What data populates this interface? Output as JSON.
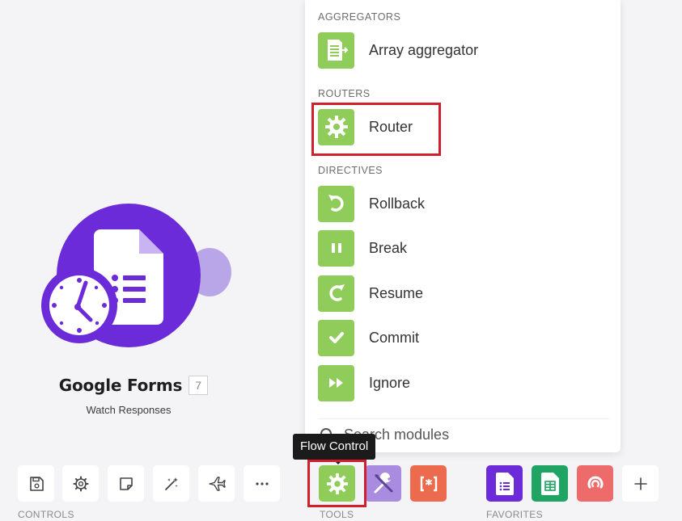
{
  "module": {
    "title": "Google Forms",
    "badge": "7",
    "subtitle": "Watch Responses",
    "color": "#6c2bd9"
  },
  "menu": {
    "sections": [
      {
        "label": "AGGREGATORS",
        "items": [
          {
            "label": "Array aggregator",
            "icon": "array-aggregator-icon"
          }
        ]
      },
      {
        "label": "ROUTERS",
        "items": [
          {
            "label": "Router",
            "icon": "gear-icon"
          }
        ]
      },
      {
        "label": "DIRECTIVES",
        "items": [
          {
            "label": "Rollback",
            "icon": "rollback-icon"
          },
          {
            "label": "Break",
            "icon": "pause-icon"
          },
          {
            "label": "Resume",
            "icon": "resume-icon"
          },
          {
            "label": "Commit",
            "icon": "checkmark-icon"
          },
          {
            "label": "Ignore",
            "icon": "fast-forward-icon"
          }
        ]
      }
    ],
    "accent": "#8fcc5a",
    "search_placeholder": "Search modules"
  },
  "tooltip": "Flow Control",
  "toolbar": {
    "controls_label": "CONTROLS",
    "tools_label": "TOOLS",
    "favorites_label": "FAVORITES",
    "controls": [
      "save-icon",
      "gear-icon",
      "note-icon",
      "magic-wand-icon",
      "airplane-icon",
      "ellipsis-icon"
    ],
    "tools": [
      "flow-control-gear-icon",
      "tools-icon",
      "text-parser-icon"
    ],
    "favorites": [
      "google-forms-icon",
      "google-sheets-icon",
      "scenario-app-icon",
      "plus-icon"
    ]
  },
  "colors": {
    "highlight": "#d0202e",
    "tools_purple": "#a98be0",
    "tools_red": "#ec6b4f",
    "sheets_green": "#1fa463",
    "favorite_red": "#ee6b6b"
  }
}
